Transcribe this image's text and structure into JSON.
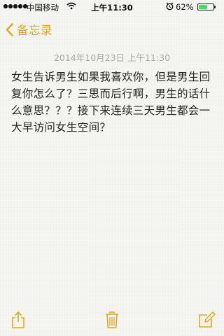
{
  "status_bar": {
    "carrier": "中国移动",
    "time": "上午11:30",
    "battery_percent_label": "62%",
    "battery_level": 0.62,
    "wifi_icon": "wifi-icon",
    "alarm_icon": "alarm-clock-icon"
  },
  "nav": {
    "back_label": "备忘录"
  },
  "note": {
    "date": "2014年10月23日 上午11:30",
    "body": "女生告诉男生如果我喜欢你，但是男生回复你怎么了？三思而后行啊，男生的话什么意思？？？接下来连续三天男生都会一大早访问女生空间？"
  },
  "toolbar": {
    "icons": [
      "share-icon",
      "trash-icon",
      "compose-icon"
    ]
  },
  "colors": {
    "accent": "#e3a818",
    "battery_fill": "#4cd964",
    "date_text": "#a8a8a8",
    "background": "#f5f5f2"
  }
}
